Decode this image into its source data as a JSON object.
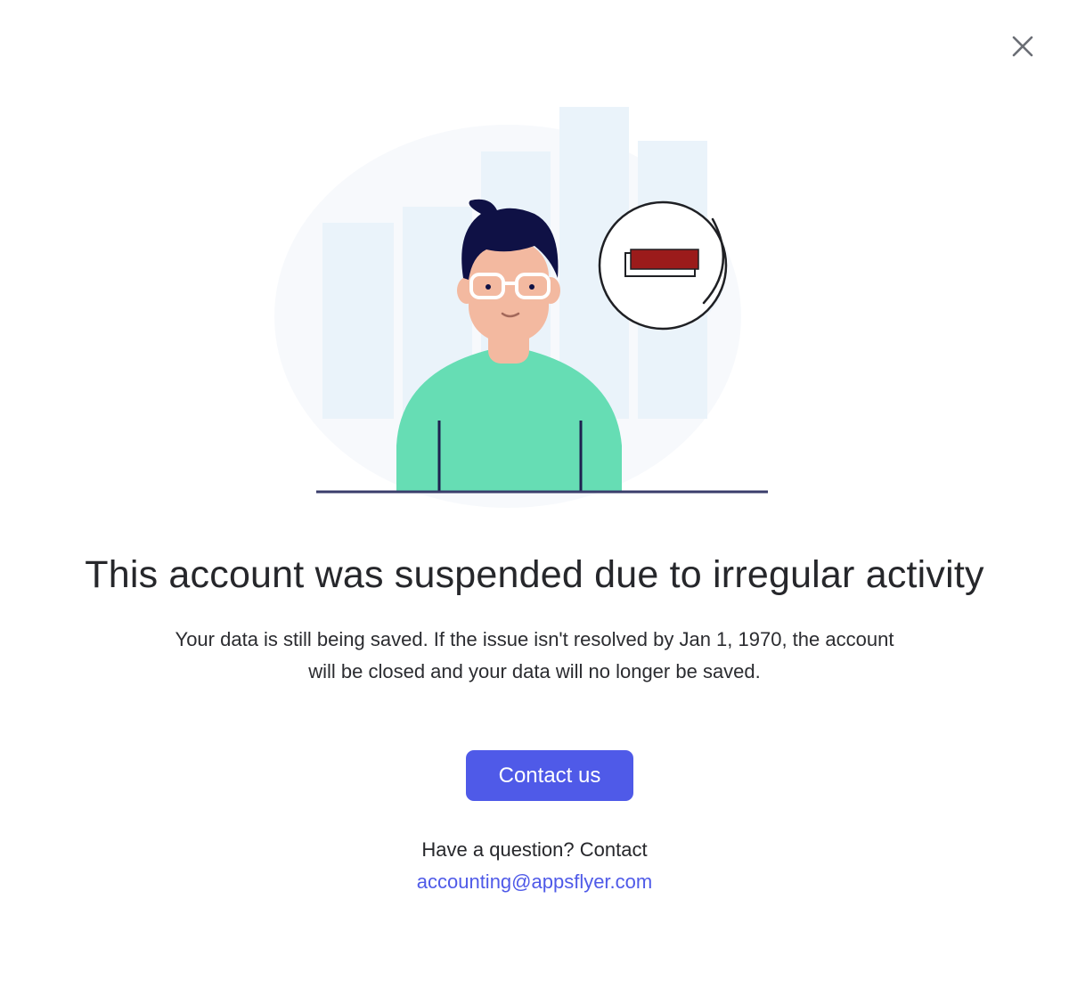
{
  "dialog": {
    "title": "This account was suspended due to irregular activity",
    "description_line1": "Your data is still being saved. If the issue isn't resolved by Jan 1, 1970, the account",
    "description_line2": "will be closed and your data will no longer be saved.",
    "contact_button_label": "Contact us",
    "question_text": "Have a question? Contact",
    "email": "accounting@appsflyer.com",
    "close_icon": "close-icon"
  },
  "illustration": {
    "subject": "person-with-suspended-badge",
    "badge_icon": "minus-icon",
    "colors": {
      "shirt": "#66ddb4",
      "hair": "#0f1145",
      "skin": "#f3b9a0",
      "bars": "#eaf3fa",
      "backdrop": "#f7f9fc",
      "badge_bar": "#9b1b1b",
      "floor_line": "#3a3d6b"
    }
  },
  "colors": {
    "accent": "#4f5ae8",
    "text": "#26272b",
    "background": "#ffffff"
  }
}
